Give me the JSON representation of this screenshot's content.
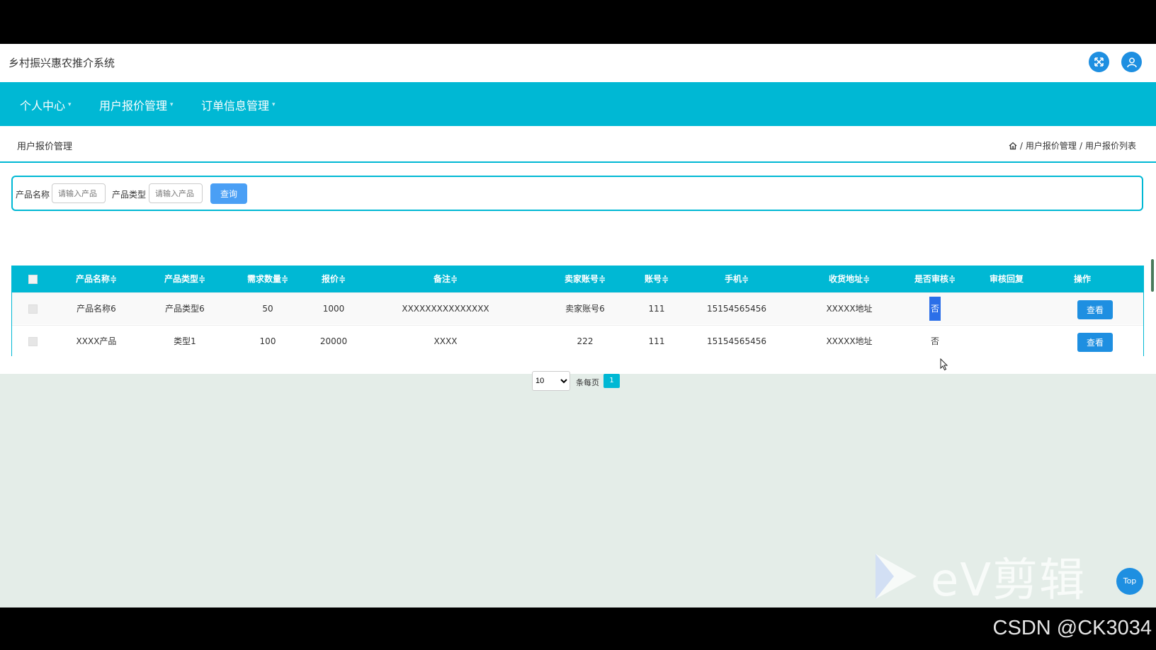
{
  "app": {
    "title": "乡村振兴惠农推介系统"
  },
  "nav": {
    "items": [
      "个人中心",
      "用户报价管理",
      "订单信息管理"
    ]
  },
  "page": {
    "title": "用户报价管理",
    "breadcrumb": [
      "用户报价管理",
      "用户报价列表"
    ],
    "breadcrumb_sep": "/"
  },
  "search": {
    "name_label": "产品名称",
    "name_placeholder": "请输入产品",
    "type_label": "产品类型",
    "type_placeholder": "请输入产品",
    "button": "查询"
  },
  "table": {
    "columns": [
      "产品名称≑",
      "产品类型≑",
      "需求数量≑",
      "报价≑",
      "备注≑",
      "卖家账号≑",
      "账号≑",
      "手机≑",
      "收货地址≑",
      "是否审核≑",
      "审核回复",
      "操作"
    ],
    "rows": [
      [
        "产品名称6",
        "产品类型6",
        "50",
        "1000",
        "XXXXXXXXXXXXXXX",
        "卖家账号6",
        "111",
        "15154565456",
        "XXXXX地址",
        "否",
        "",
        "查看"
      ],
      [
        "XXXX产品",
        "类型1",
        "100",
        "20000",
        "XXXX",
        "222",
        "111",
        "15154565456",
        "XXXXX地址",
        "否",
        "",
        "查看"
      ]
    ]
  },
  "pagination": {
    "page_size": "10",
    "per_page_label": "条每页",
    "current_page": "1"
  },
  "overlay": {
    "watermark": "eV剪辑",
    "top_button": "Top",
    "credit": "CSDN @CK3034"
  },
  "colors": {
    "nav_bg": "#00b8d4",
    "button_blue": "#1e8fe1",
    "page_bg": "#e4ede8"
  }
}
